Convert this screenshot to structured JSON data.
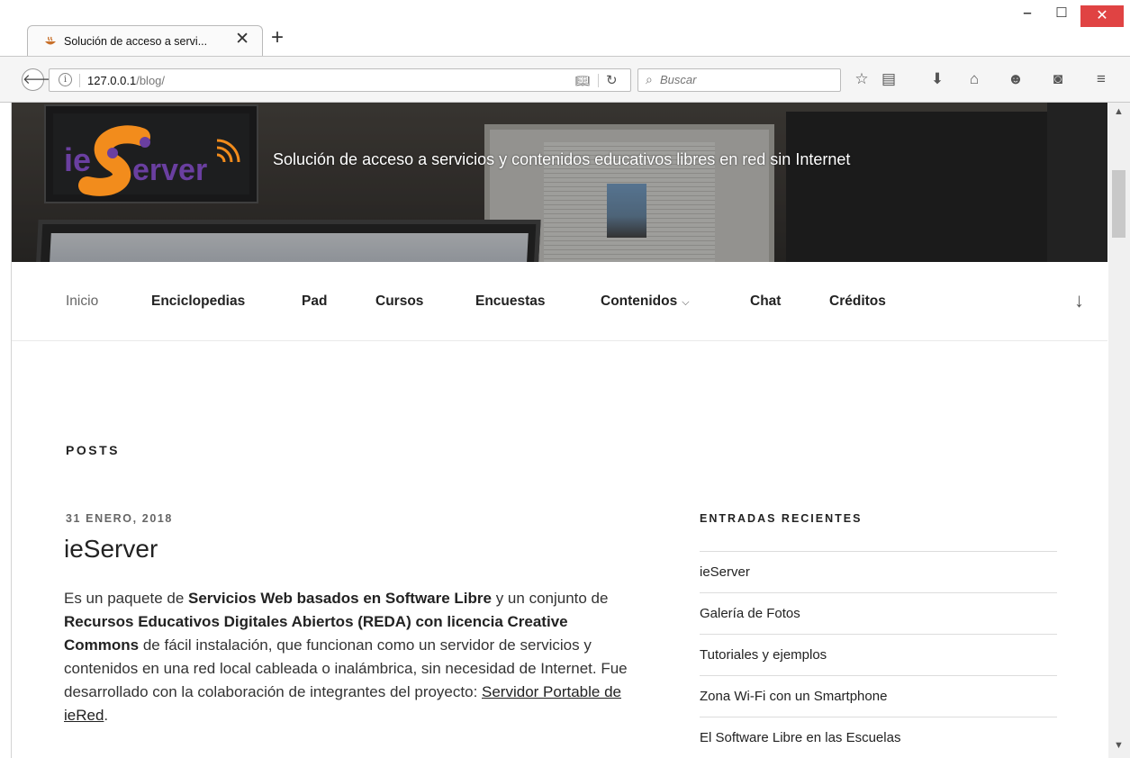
{
  "browser": {
    "tab_title": "Solución de acceso a servi...",
    "tab_close": "✕",
    "new_tab": "+",
    "url_host": "127.0.0.1",
    "url_path": "/blog/",
    "search_placeholder": "Buscar",
    "icons": [
      "back-icon",
      "info-icon",
      "reader-view-icon",
      "reload-icon",
      "search-icon",
      "bookmark-star-icon",
      "bookmarks-library-icon",
      "download-icon",
      "home-icon",
      "chat-icon",
      "pocket-icon",
      "menu-icon"
    ]
  },
  "window": {
    "minimize": "‒",
    "maximize": "☐",
    "close": "✕"
  },
  "site": {
    "logo_text": "ieServer",
    "tagline": "Solución de acceso a servicios y contenidos educativos libres en red sin Internet",
    "brand_colors": {
      "orange": "#f28c1c",
      "purple": "#6a3fa0"
    }
  },
  "menu": {
    "items": [
      {
        "label": "Inicio",
        "active": false
      },
      {
        "label": "Enciclopedias"
      },
      {
        "label": "Pad"
      },
      {
        "label": "Cursos"
      },
      {
        "label": "Encuestas"
      },
      {
        "label": "Contenidos",
        "has_dropdown": true
      },
      {
        "label": "Chat"
      },
      {
        "label": "Créditos"
      }
    ]
  },
  "main": {
    "section_title": "POSTS",
    "post": {
      "date": "31 ENERO, 2018",
      "title": "ieServer",
      "body": {
        "t1": "Es un paquete de ",
        "b1": "Servicios Web basados en Software Libre",
        "t2": " y un conjunto de ",
        "b2": "Recursos Educativos Digitales Abiertos (REDA) con licencia Creative Commons",
        "t3": " de fácil instalación, que funcionan como un servidor de servicios y contenidos en una red local cableada o inalámbrica, sin necesidad de Internet. Fue desarrollado con la colaboración de integrantes del proyecto: ",
        "link": "Servidor Portable de ieRed",
        "t4": "."
      }
    }
  },
  "sidebar": {
    "widget_title": "ENTRADAS RECIENTES",
    "recent_posts": [
      "ieServer",
      "Galería de Fotos",
      "Tutoriales y ejemplos",
      "Zona Wi-Fi con un Smartphone",
      "El Software Libre en las Escuelas"
    ]
  }
}
